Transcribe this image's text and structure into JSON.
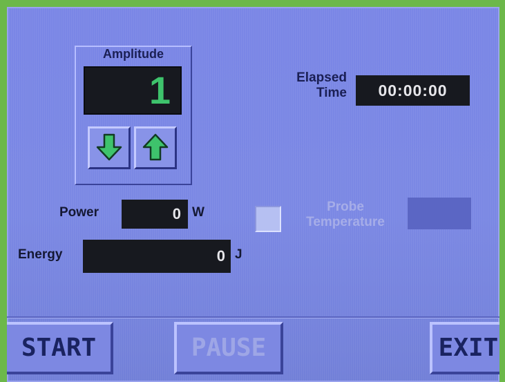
{
  "amplitude": {
    "title": "Amplitude",
    "value": "1",
    "down_icon": "down-arrow-icon",
    "up_icon": "up-arrow-icon",
    "arrow_color": "#3ec36c"
  },
  "elapsed": {
    "label_line1": "Elapsed",
    "label_line2": "Time",
    "value": "00:00:00"
  },
  "power": {
    "label": "Power",
    "value": "0",
    "unit": "W"
  },
  "energy": {
    "label": "Energy",
    "value": "0",
    "unit": "J"
  },
  "probe": {
    "label_line1": "Probe",
    "label_line2": "Temperature",
    "value": "",
    "enabled": false
  },
  "buttons": {
    "start": "START",
    "pause": "PAUSE",
    "exit": "EXIT"
  },
  "colors": {
    "screen_bg": "#7a86e6",
    "display_bg": "#17191f",
    "amplitude_digit": "#3ec36c",
    "frame_green": "#6cb84a"
  }
}
